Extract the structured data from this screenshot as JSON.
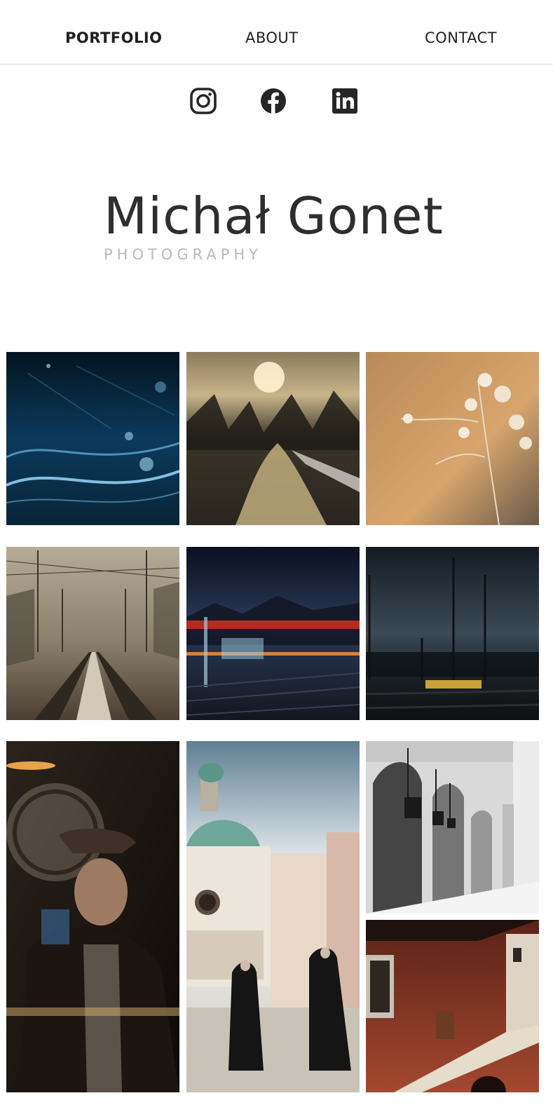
{
  "nav": {
    "items": [
      {
        "label": "PORTFOLIO",
        "active": true
      },
      {
        "label": "ABOUT",
        "active": false
      },
      {
        "label": "CONTACT",
        "active": false
      }
    ]
  },
  "social": {
    "icons": [
      "instagram-icon",
      "facebook-icon",
      "linkedin-icon"
    ]
  },
  "brand": {
    "name": "Michał Gonet",
    "subtitle": "PHOTOGRAPHY"
  },
  "gallery": {
    "photos": [
      "ice-abstract-photo",
      "river-sunset-photo",
      "dried-flower-photo",
      "railway-tracks-photo",
      "train-night-photo",
      "railway-dusk-photo",
      "man-in-hat-pub-photo",
      "nuns-old-town-photo",
      "cloth-hall-arcade-photo",
      "brick-courtyard-photo"
    ]
  },
  "colors": {
    "text": "#2b2b2b",
    "subtitle": "#b9b9b9",
    "divider": "#d6d6d6"
  }
}
